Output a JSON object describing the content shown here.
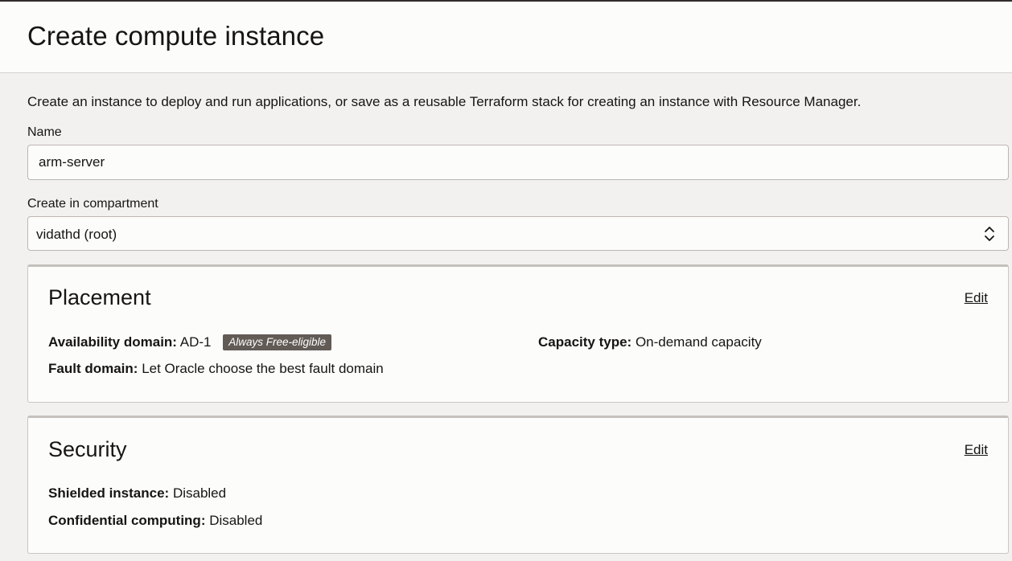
{
  "header": {
    "title": "Create compute instance"
  },
  "intro": "Create an instance to deploy and run applications, or save as a reusable Terraform stack for creating an instance with Resource Manager.",
  "name_field": {
    "label": "Name",
    "value": "arm-server"
  },
  "compartment_field": {
    "label": "Create in compartment",
    "value": "vidathd (root)"
  },
  "placement": {
    "title": "Placement",
    "edit_label": "Edit",
    "availability_domain_label": "Availability domain:",
    "availability_domain_value": "AD-1",
    "badge": "Always Free-eligible",
    "capacity_type_label": "Capacity type:",
    "capacity_type_value": "On-demand capacity",
    "fault_domain_label": "Fault domain:",
    "fault_domain_value": "Let Oracle choose the best fault domain"
  },
  "security": {
    "title": "Security",
    "edit_label": "Edit",
    "shielded_label": "Shielded instance:",
    "shielded_value": "Disabled",
    "confidential_label": "Confidential computing:",
    "confidential_value": "Disabled"
  },
  "colors": {
    "page_bg": "#f2f1f0",
    "surface": "#fcfcfb",
    "text": "#161513",
    "badge_bg": "#615a55"
  },
  "icons": {
    "compartment_select": "chevron-updown-icon"
  }
}
